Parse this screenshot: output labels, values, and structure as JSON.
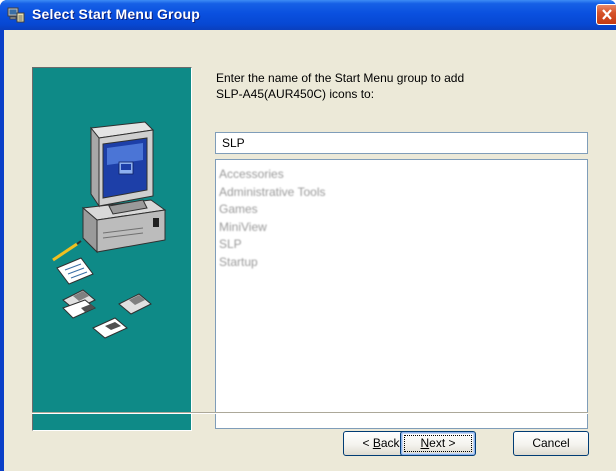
{
  "window": {
    "title": "Select Start Menu Group",
    "title_icon": "installer-icon",
    "close_icon": "close-icon"
  },
  "prompt": {
    "line1": "Enter the name of the Start Menu group to add",
    "line2": "SLP-A45(AUR450C) icons to:"
  },
  "group_input": {
    "value": "SLP"
  },
  "group_list": {
    "items": [
      "Accessories",
      "Administrative Tools",
      "Games",
      "MiniView",
      "SLP",
      "Startup"
    ]
  },
  "buttons": {
    "back_prefix": "< ",
    "back_mnemonic": "B",
    "back_rest": "ack",
    "next_mnemonic": "N",
    "next_rest": "ext >",
    "cancel_label": "Cancel"
  },
  "colors": {
    "titlebar": "#0a50df",
    "dialog_face": "#ece9d8",
    "art_background": "#0e8a87",
    "close_button": "#d6532a"
  }
}
